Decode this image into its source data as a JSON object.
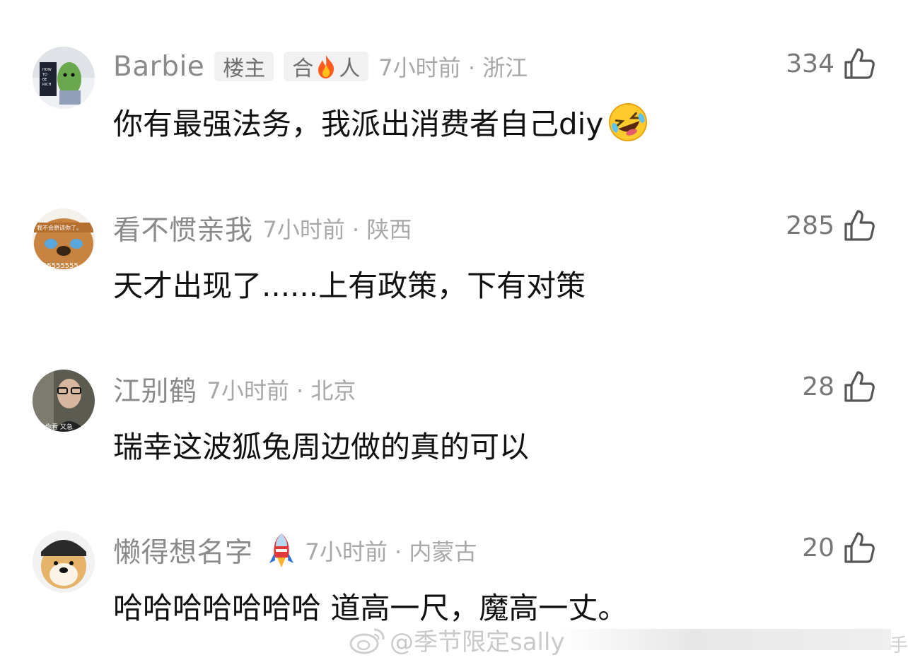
{
  "comments": [
    {
      "username": "Barbie",
      "tags": [
        "楼主",
        "合",
        "人"
      ],
      "time": "7小时前 · 浙江",
      "text": "你有最强法务，我派出消费者自己diy",
      "likes": "334",
      "avatar_text": [
        "HOW",
        "TO",
        "BE",
        "RICH"
      ]
    },
    {
      "username": "看不惯亲我",
      "time": "7小时前 · 陕西",
      "text": "天才出现了......上有政策，下有对策",
      "likes": "285",
      "avatar_text": [
        "我不会原谅你了。",
        "55555555"
      ]
    },
    {
      "username": "江别鹤",
      "time": "7小时前 · 北京",
      "text": "瑞幸这波狐兔周边做的真的可以",
      "likes": "28",
      "avatar_text": [
        "你看 又急"
      ]
    },
    {
      "username": "懒得想名字",
      "time": "7小时前 · 内蒙古",
      "text": "哈哈哈哈哈哈哈 道高一尺，魔高一丈。",
      "likes": "20"
    }
  ],
  "watermark": {
    "text": "@季节限定sally",
    "edge_glyph": "手"
  },
  "colors": {
    "username": "#8a8a8a",
    "time": "#a8a8a8",
    "text": "#111111",
    "tag_bg": "#f1f1f1"
  }
}
